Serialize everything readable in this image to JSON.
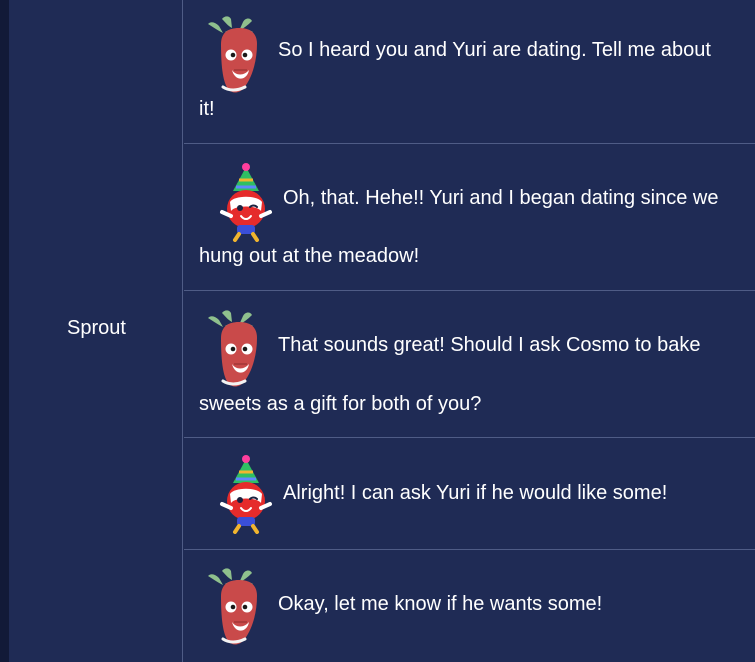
{
  "speaker": {
    "label": "Sprout"
  },
  "messages": [
    {
      "avatar": "strawberry-character-icon",
      "line1": "So I heard you and Yuri are dating. Tell me about",
      "line2": "it!"
    },
    {
      "avatar": "party-hat-character-icon",
      "line1": "Oh, that. Hehe!! Yuri and I began dating since we",
      "line2": "hung out at the meadow!"
    },
    {
      "avatar": "strawberry-character-icon",
      "line1": "That sounds great! Should I ask Cosmo to bake",
      "line2": "sweets as a gift for both of you?"
    },
    {
      "avatar": "party-hat-character-icon",
      "line1": "Alright! I can ask Yuri if he would like some!"
    },
    {
      "avatar": "strawberry-character-icon",
      "line1": "Okay, let me know if he wants some!"
    }
  ],
  "colors": {
    "background": "#1f2b55",
    "border": "#4f5c86",
    "text": "#ffffff",
    "strawberry": "#c94a4a",
    "leaf": "#8fc08d",
    "party_hat": "#2fbf63",
    "party_face": "#e52b2b",
    "party_body": "#3a4fd8",
    "party_accent": "#f1b52f"
  }
}
